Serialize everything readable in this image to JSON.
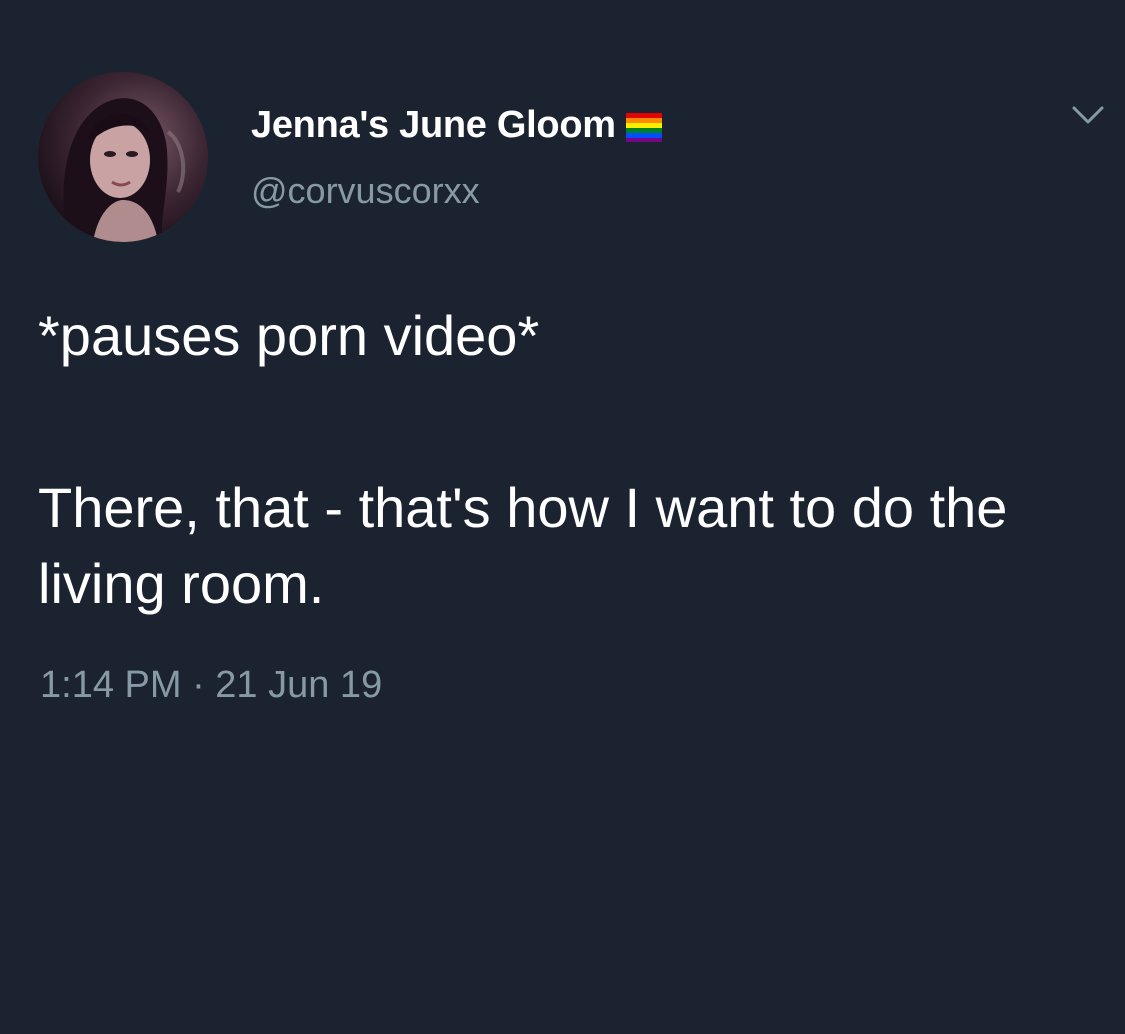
{
  "user": {
    "display_name": "Jenna's June Gloom",
    "handle": "@corvuscorxx",
    "avatar_icon": "profile-photo",
    "badge_icon": "rainbow-flag-icon"
  },
  "menu": {
    "icon": "chevron-down-icon"
  },
  "tweet": {
    "line1": "*pauses porn video*",
    "line2": "There, that - that's how I want to do the living room.",
    "timestamp": "1:14 PM · 21 Jun 19"
  },
  "colors": {
    "background": "#1c2330",
    "text": "#ffffff",
    "secondary_text": "#8899a6"
  }
}
